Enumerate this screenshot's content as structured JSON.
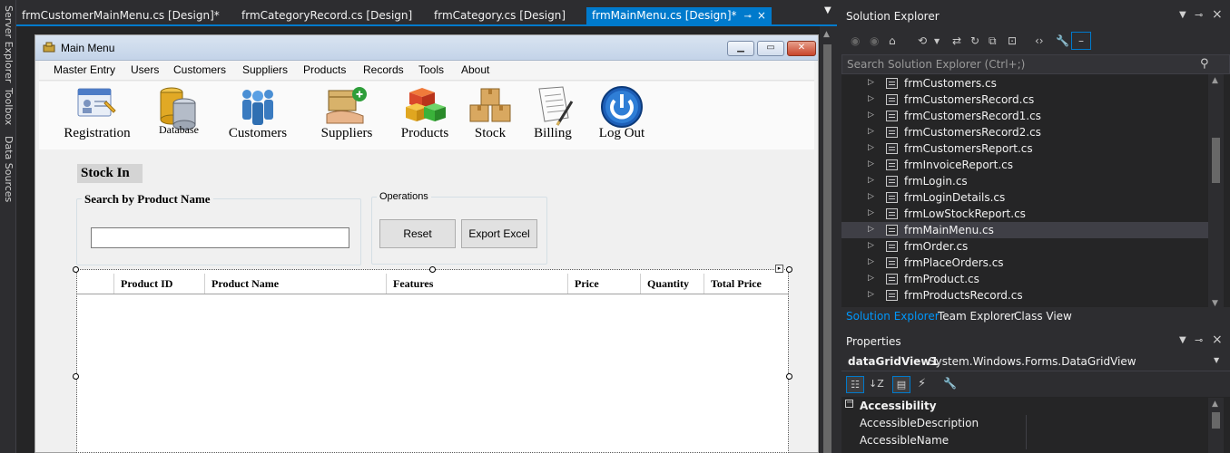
{
  "side_tabs": [
    "Server Explorer",
    "Toolbox",
    "Data Sources"
  ],
  "doc_tabs": [
    {
      "label": "frmCustomerMainMenu.cs [Design]*"
    },
    {
      "label": "frmCategoryRecord.cs [Design]"
    },
    {
      "label": "frmCategory.cs [Design]"
    },
    {
      "label": "frmMainMenu.cs [Design]*",
      "active": true
    }
  ],
  "form": {
    "title": "Main Menu",
    "menu": [
      "Master Entry",
      "Users",
      "Customers",
      "Suppliers",
      "Products",
      "Records",
      "Tools",
      "About"
    ],
    "toolbar": [
      {
        "label": "Registration",
        "icon": "registration-icon"
      },
      {
        "label": "Database",
        "icon": "database-icon"
      },
      {
        "label": "Customers",
        "icon": "customers-icon"
      },
      {
        "label": "Suppliers",
        "icon": "suppliers-icon"
      },
      {
        "label": "Products",
        "icon": "products-icon"
      },
      {
        "label": "Stock",
        "icon": "stock-icon"
      },
      {
        "label": "Billing",
        "icon": "billing-icon"
      },
      {
        "label": "Log Out",
        "icon": "logout-icon"
      }
    ],
    "section_label": "Stock In",
    "search_group": {
      "title": "Search by Product Name",
      "value": ""
    },
    "operations_group": {
      "title": "Operations",
      "reset_label": "Reset",
      "export_label": "Export Excel"
    },
    "grid_columns": [
      "Product ID",
      "Product Name",
      "Features",
      "Price",
      "Quantity",
      "Total Price"
    ]
  },
  "solution_explorer": {
    "title": "Solution Explorer",
    "search_placeholder": "Search Solution Explorer (Ctrl+;)",
    "files": [
      "frmCustomers.cs",
      "frmCustomersRecord.cs",
      "frmCustomersRecord1.cs",
      "frmCustomersRecord2.cs",
      "frmCustomersReport.cs",
      "frmInvoiceReport.cs",
      "frmLogin.cs",
      "frmLoginDetails.cs",
      "frmLowStockReport.cs",
      "frmMainMenu.cs",
      "frmOrder.cs",
      "frmPlaceOrders.cs",
      "frmProduct.cs",
      "frmProductsRecord.cs"
    ],
    "selected": "frmMainMenu.cs",
    "tabs": [
      "Solution Explorer",
      "Team Explorer",
      "Class View"
    ]
  },
  "properties": {
    "title": "Properties",
    "object_name": "dataGridView1",
    "object_type": "System.Windows.Forms.DataGridView",
    "category": "Accessibility",
    "rows": [
      "AccessibleDescription",
      "AccessibleName"
    ]
  },
  "colors": {
    "accent": "#007acc",
    "panel_bg": "#252526",
    "chrome_bg": "#2d2d30",
    "form_bg": "#f0f0f0"
  }
}
